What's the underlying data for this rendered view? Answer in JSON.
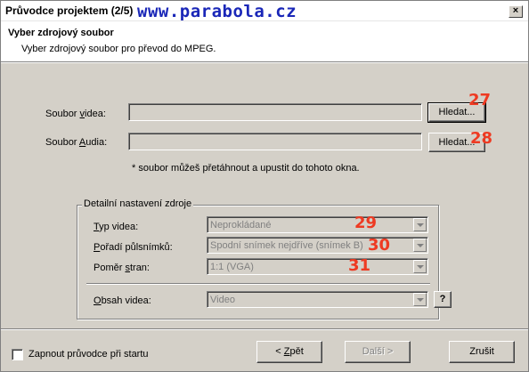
{
  "window": {
    "title": "Průvodce projektem (2/5)",
    "watermark": "www.parabola.cz",
    "close_glyph": "×"
  },
  "header": {
    "title": "Vyber zdrojový soubor",
    "subtitle": "Vyber zdrojový soubor pro převod do MPEG."
  },
  "source": {
    "video_label_pre": "Soubor ",
    "video_label_accel": "v",
    "video_label_post": "idea:",
    "video_value": "",
    "video_browse": "Hledat...",
    "audio_label_pre": "Soubor ",
    "audio_label_accel": "A",
    "audio_label_post": "udia:",
    "audio_value": "",
    "audio_browse": "Hledat...",
    "drop_hint": "* soubor můžeš přetáhnout a upustit do tohoto okna."
  },
  "details": {
    "group_title": "Detailní nastavení zdroje",
    "video_type_accel": "T",
    "video_type_rest": "yp videa:",
    "video_type_value": "Neprokládané",
    "field_order_pre": "",
    "field_order_accel": "P",
    "field_order_rest": "ořadí půlsnímků:",
    "field_order_value": "Spodní snímek nejdříve (snímek B)",
    "aspect_pre": "Poměr ",
    "aspect_accel": "s",
    "aspect_rest": "tran:",
    "aspect_value": "1:1 (VGA)",
    "content_accel": "O",
    "content_rest": "bsah videa:",
    "content_value": "Video",
    "help_label": "?"
  },
  "badges": [
    "27",
    "28",
    "29",
    "30",
    "31"
  ],
  "footer": {
    "startup_checkbox_label": "Zapnout průvodce při startu",
    "startup_checked": false,
    "back_pre": "< ",
    "back_accel": "Z",
    "back_rest": "pět",
    "next_label": "Další >",
    "cancel_label": "Zrušit"
  },
  "colors": {
    "face": "#d4d0c8",
    "watermark": "#1a27b8",
    "badge": "#ee3a22"
  }
}
